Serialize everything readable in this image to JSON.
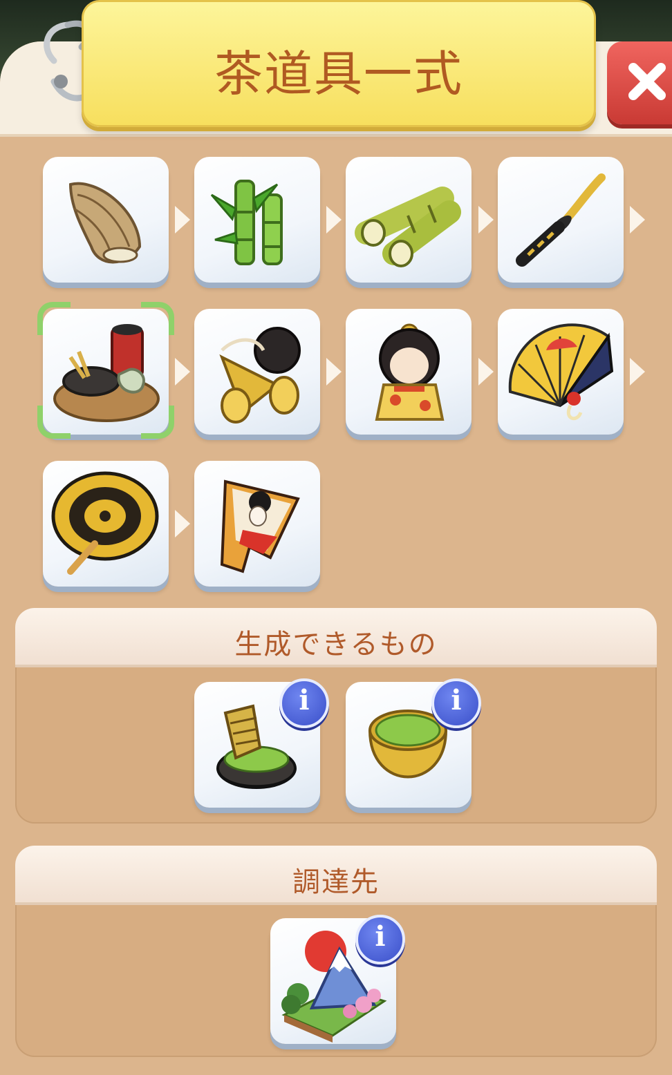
{
  "dialog": {
    "title": "茶道具一式",
    "close_icon": "close-x-icon"
  },
  "chain": {
    "items": [
      {
        "name": "bamboo-shoot",
        "icon": "bamboo-shoot-icon"
      },
      {
        "name": "bamboo-plant",
        "icon": "bamboo-plant-icon"
      },
      {
        "name": "bamboo-logs",
        "icon": "bamboo-logs-icon"
      },
      {
        "name": "katana",
        "icon": "katana-icon"
      },
      {
        "name": "tea-set",
        "icon": "tea-set-icon",
        "selected": true
      },
      {
        "name": "kendama",
        "icon": "kendama-icon"
      },
      {
        "name": "kokeshi-doll",
        "icon": "kokeshi-doll-icon"
      },
      {
        "name": "folding-fan",
        "icon": "folding-fan-icon"
      },
      {
        "name": "paper-umbrella",
        "icon": "paper-umbrella-icon"
      },
      {
        "name": "hagoita-paddle",
        "icon": "hagoita-paddle-icon"
      }
    ]
  },
  "produces": {
    "title": "生成できるもの",
    "items": [
      {
        "name": "matcha-bowl",
        "icon": "matcha-bowl-icon"
      },
      {
        "name": "matcha-powder",
        "icon": "matcha-powder-icon"
      }
    ]
  },
  "source": {
    "title": "調達先",
    "items": [
      {
        "name": "mount-fuji-island",
        "icon": "mount-fuji-icon"
      }
    ]
  },
  "info_label": "i",
  "colors": {
    "panel": "#dcb58d",
    "title_banner": "#f7df5e",
    "title_text": "#b05a22",
    "close_button": "#d9443e",
    "info_badge": "#4a5fd6",
    "selection_bracket": "#8fd16a"
  }
}
